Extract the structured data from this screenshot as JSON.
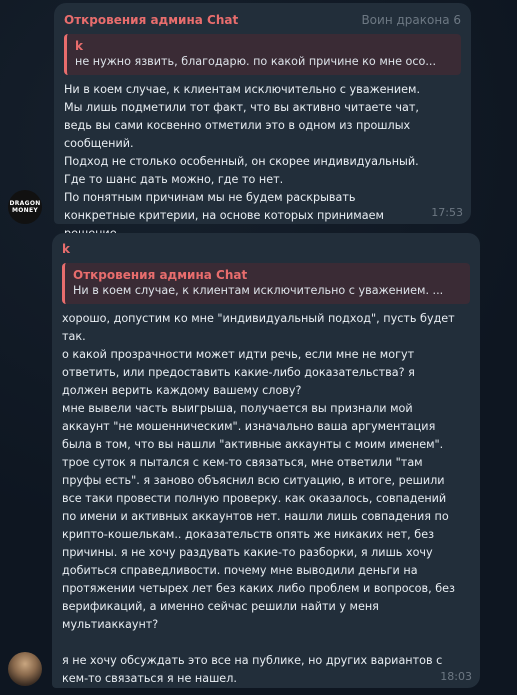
{
  "messages": [
    {
      "author": "Откровения админа Chat",
      "admin_title": "Воин дракона 6",
      "reply": {
        "author": "k",
        "text": "не нужно язвить, благодарю.  по какой причине ко мне осо..."
      },
      "paragraphs": [
        "Ни в коем случае, к клиентам исключительно с уважением.",
        "Мы лишь подметили тот факт, что вы активно читаете чат, ведь вы сами косвенно отметили это в одном из прошлых сообщений.",
        "Подход не столько особенный, он скорее индивидуальный.",
        "Где то шанс дать можно, где то нет.",
        "По понятным причинам мы не будем раскрывать конкретные критерии, на основе которых принимаем решение."
      ],
      "time": "17:53",
      "avatar_text": [
        "DRAGON",
        "MONEY"
      ]
    },
    {
      "author": "k",
      "reply": {
        "author": "Откровения админа Chat",
        "text": "Ни в коем случае, к клиентам исключительно с уважением. ..."
      },
      "paragraphs": [
        "хорошо, допустим ко мне \"индивидуальный подход\", пусть будет так.",
        "о какой прозрачности может идти речь, если мне не могут ответить, или предоставить какие-либо доказательства? я должен верить каждому вашему слову?",
        "мне вывели часть выигрыша, получается вы признали мой аккаунт \"не мошенническим\". изначально ваша аргументация была в том, что вы нашли \"активные аккаунты с моим именем\". трое суток я пытался с кем-то связаться, мне ответили \"там пруфы есть\". я заново объяснил всю ситуацию, в итоге, решили все таки провести полную проверку. как оказалось, совпадений по имени и активных аккаунтов нет. нашли лишь совпадения по крипто-кошелькам.. доказательств опять же никаких нет, без причины. я не хочу раздувать какие-то разборки, я лишь хочу добиться справедливости. почему мне выводили деньги на протяжении четырех лет без каких либо проблем и вопросов, без верификаций, а именно сейчас решили найти у меня мультиаккаунт?",
        "",
        "я не хочу обсуждать это все на публике, но других вариантов с кем-то связаться я не нашел."
      ],
      "time": "18:03"
    }
  ]
}
